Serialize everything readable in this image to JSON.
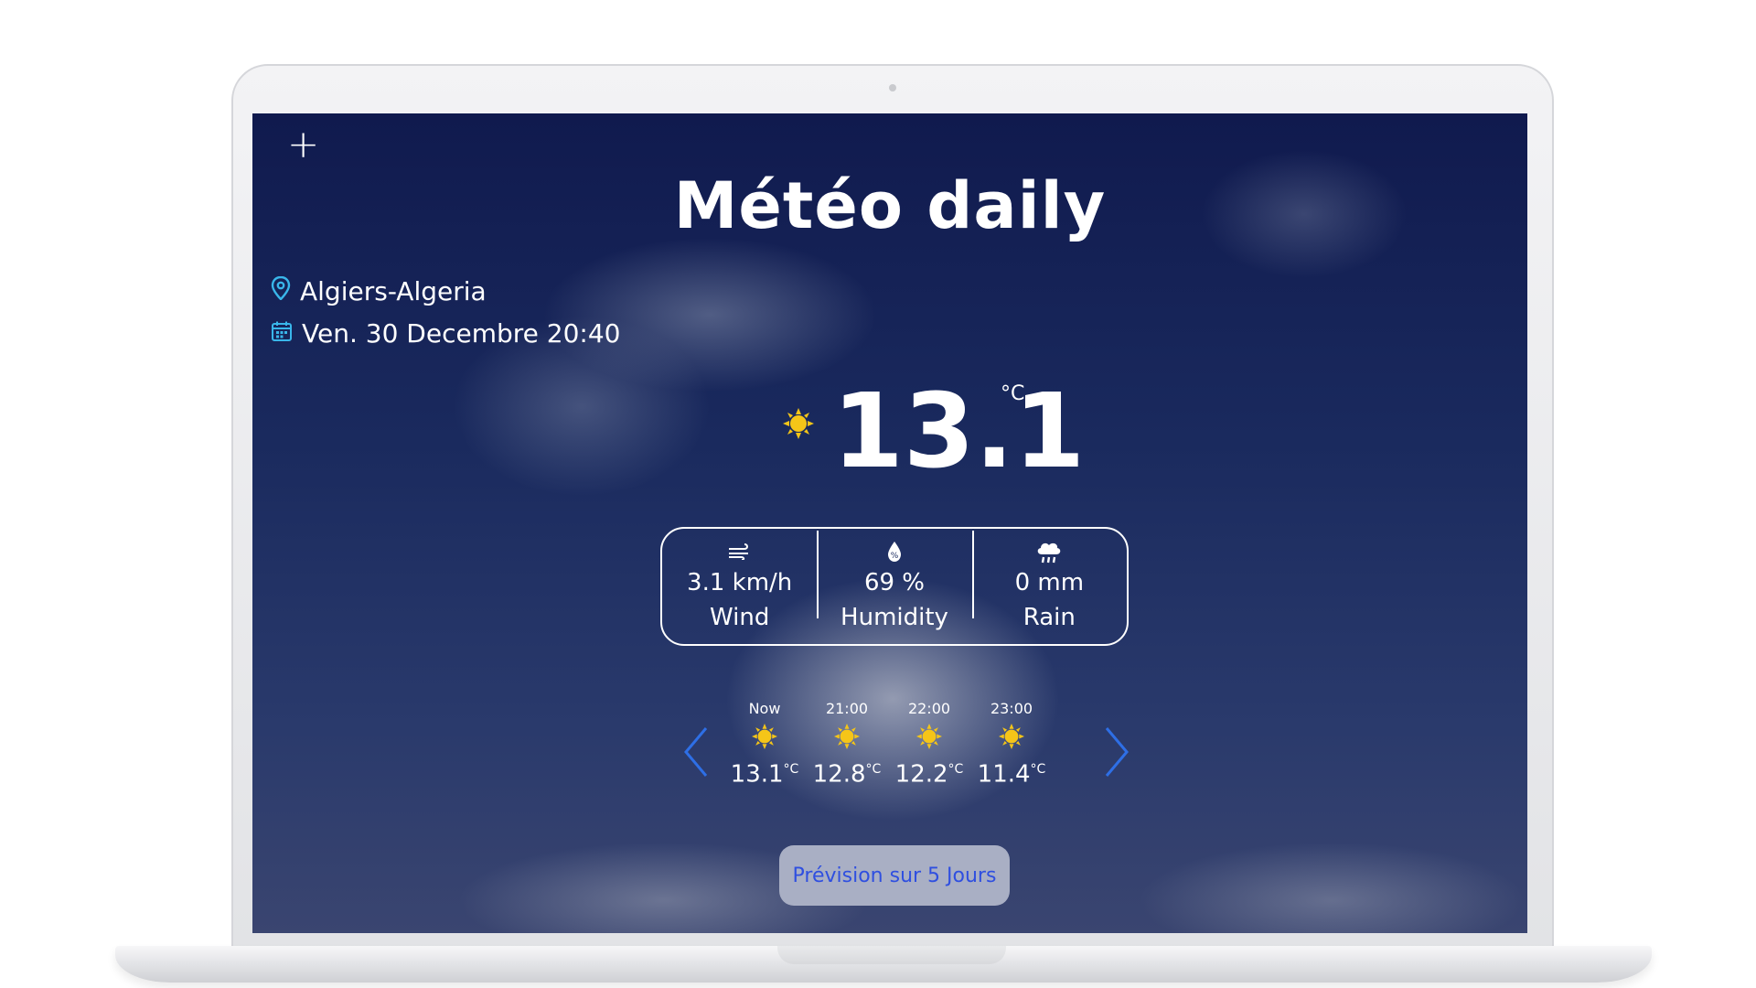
{
  "app": {
    "title": "Météo daily",
    "add_button": "+",
    "location": "Algiers-Algeria",
    "datetime": "Ven. 30 Decembre 20:40"
  },
  "current": {
    "temperature": "13.1",
    "unit": "°C",
    "condition_icon": "sun-icon"
  },
  "stats": [
    {
      "icon": "wind-icon",
      "value": "3.1 km/h",
      "label": "Wind"
    },
    {
      "icon": "humidity-icon",
      "value": "69 %",
      "label": "Humidity"
    },
    {
      "icon": "rain-cloud-icon",
      "value": "0 mm",
      "label": "Rain"
    }
  ],
  "hourly": [
    {
      "time": "Now",
      "temp": "13.1",
      "unit": "°C",
      "icon": "sun-icon"
    },
    {
      "time": "21:00",
      "temp": "12.8",
      "unit": "°C",
      "icon": "sun-icon"
    },
    {
      "time": "22:00",
      "temp": "12.2",
      "unit": "°C",
      "icon": "sun-icon"
    },
    {
      "time": "23:00",
      "temp": "11.4",
      "unit": "°C",
      "icon": "sun-icon"
    }
  ],
  "nav": {
    "prev": "‹",
    "next": "›"
  },
  "forecast_button": "Prévision sur 5 Jours",
  "colors": {
    "accent": "#2e6fe6",
    "sun": "#f5c518",
    "button_bg": "#a9afc4",
    "button_text": "#2f4fe0"
  }
}
